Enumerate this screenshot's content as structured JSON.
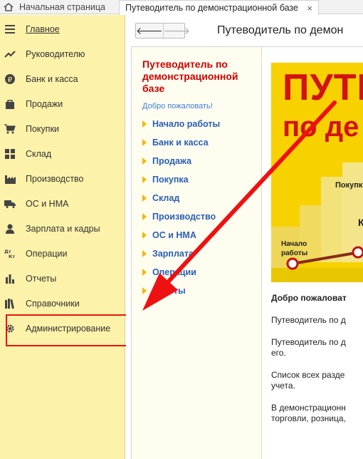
{
  "tabs": {
    "home_label": "Начальная страница",
    "active_label": "Путеводитель по демонстрационной базе",
    "close_glyph": "×"
  },
  "sidebar": {
    "items": [
      {
        "label": "Главное",
        "icon": "menu-icon",
        "active": true
      },
      {
        "label": "Руководителю",
        "icon": "trend-icon"
      },
      {
        "label": "Банк и касса",
        "icon": "ruble-icon"
      },
      {
        "label": "Продажи",
        "icon": "bag-icon"
      },
      {
        "label": "Покупки",
        "icon": "cart-icon"
      },
      {
        "label": "Склад",
        "icon": "warehouse-icon"
      },
      {
        "label": "Производство",
        "icon": "factory-icon"
      },
      {
        "label": "ОС и НМА",
        "icon": "truck-icon"
      },
      {
        "label": "Зарплата и кадры",
        "icon": "person-icon"
      },
      {
        "label": "Операции",
        "icon": "dt-kt-icon"
      },
      {
        "label": "Отчеты",
        "icon": "bar-chart-icon"
      },
      {
        "label": "Справочники",
        "icon": "books-icon"
      },
      {
        "label": "Администрирование",
        "icon": "gear-icon"
      }
    ]
  },
  "toolbar": {
    "back_glyph": "🡐",
    "forward_glyph": "🡒",
    "title": "Путеводитель по демон"
  },
  "guide": {
    "title": "Путеводитель по демонстрационной базе",
    "welcome": "Добро пожаловать!",
    "items": [
      "Начало работы",
      "Банк и касса",
      "Продажа",
      "Покупка",
      "Склад",
      "Производство",
      "ОС и НМА",
      "Зарплата",
      "Операции",
      "Отчеты"
    ]
  },
  "poster": {
    "line1": "ПУТЕ",
    "line2": "по де",
    "label_purchase": "Покупк",
    "label_k": "К",
    "label_start": "Начало работы"
  },
  "doc": {
    "heading": "Добро пожаловат",
    "p1": "Путеводитель по д",
    "p2a": "Путеводитель по д",
    "p2b": "его.",
    "p3a": "Список всех разде",
    "p3b": "учета.",
    "p4a": "В демонстрационн",
    "p4b": "торговли, розница,"
  },
  "colors": {
    "sidebar_bg": "#fdf2a9",
    "accent_red": "#e11",
    "link_blue": "#2b5fb4",
    "poster_yellow": "#f7d100"
  }
}
